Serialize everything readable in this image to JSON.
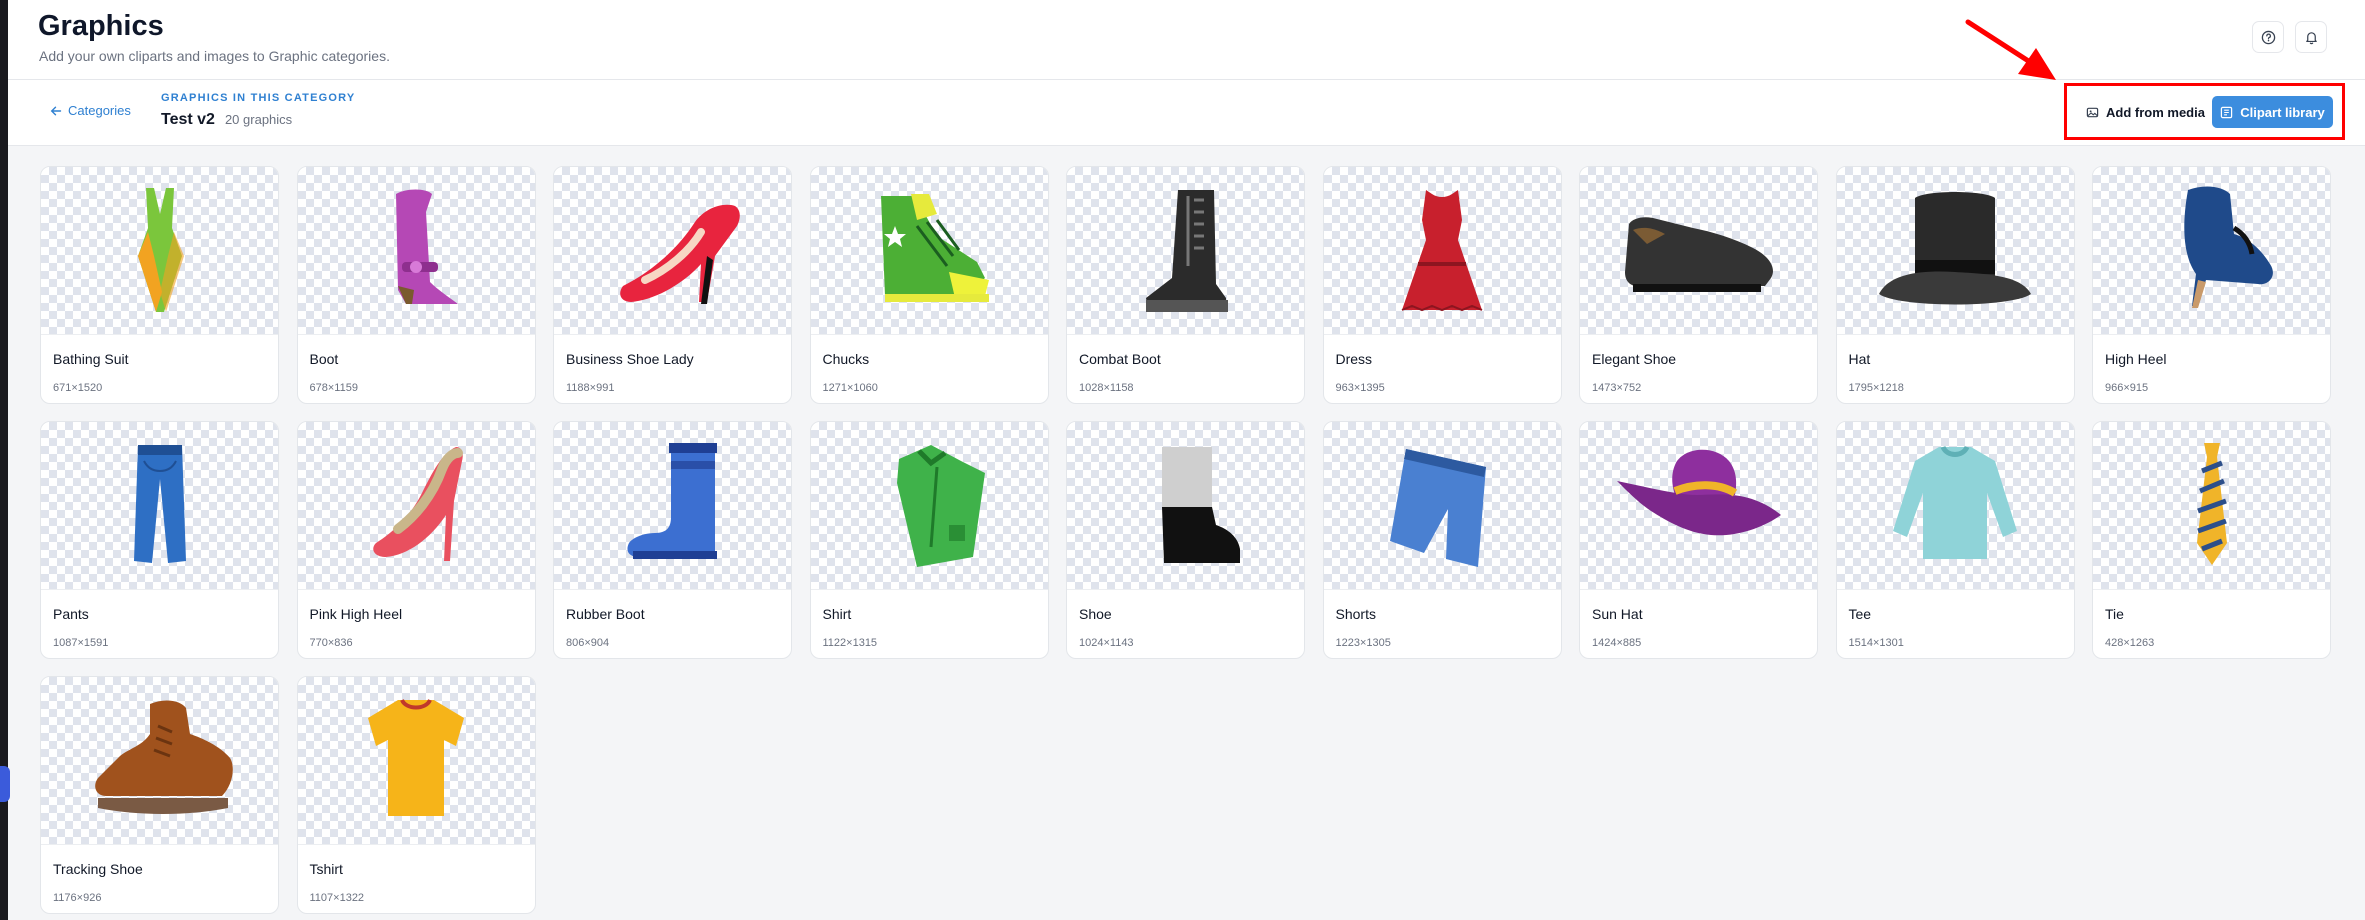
{
  "header": {
    "title": "Graphics",
    "subtitle": "Add your own cliparts and images to Graphic categories.",
    "icons": [
      "help-icon",
      "bell-icon"
    ]
  },
  "subbar": {
    "back_label": "Categories",
    "overline": "GRAPHICS IN THIS CATEGORY",
    "category_name": "Test v2",
    "count_label": "20 graphics",
    "add_media_label": "Add from media",
    "clipart_label": "Clipart library"
  },
  "colors": {
    "accent": "#3c8dde",
    "link": "#2f80d1",
    "annotation": "#ff0000"
  },
  "graphics": [
    {
      "name": "Bathing Suit",
      "dims": "671×1520",
      "icon": "bathing-suit-icon"
    },
    {
      "name": "Boot",
      "dims": "678×1159",
      "icon": "boot-icon"
    },
    {
      "name": "Business Shoe Lady",
      "dims": "1188×991",
      "icon": "business-shoe-lady-icon"
    },
    {
      "name": "Chucks",
      "dims": "1271×1060",
      "icon": "chucks-icon"
    },
    {
      "name": "Combat Boot",
      "dims": "1028×1158",
      "icon": "combat-boot-icon"
    },
    {
      "name": "Dress",
      "dims": "963×1395",
      "icon": "dress-icon"
    },
    {
      "name": "Elegant Shoe",
      "dims": "1473×752",
      "icon": "elegant-shoe-icon"
    },
    {
      "name": "Hat",
      "dims": "1795×1218",
      "icon": "hat-icon"
    },
    {
      "name": "High Heel",
      "dims": "966×915",
      "icon": "high-heel-icon"
    },
    {
      "name": "Pants",
      "dims": "1087×1591",
      "icon": "pants-icon"
    },
    {
      "name": "Pink High Heel",
      "dims": "770×836",
      "icon": "pink-high-heel-icon"
    },
    {
      "name": "Rubber Boot",
      "dims": "806×904",
      "icon": "rubber-boot-icon"
    },
    {
      "name": "Shirt",
      "dims": "1122×1315",
      "icon": "shirt-icon"
    },
    {
      "name": "Shoe",
      "dims": "1024×1143",
      "icon": "shoe-icon"
    },
    {
      "name": "Shorts",
      "dims": "1223×1305",
      "icon": "shorts-icon"
    },
    {
      "name": "Sun Hat",
      "dims": "1424×885",
      "icon": "sun-hat-icon"
    },
    {
      "name": "Tee",
      "dims": "1514×1301",
      "icon": "tee-icon"
    },
    {
      "name": "Tie",
      "dims": "428×1263",
      "icon": "tie-icon"
    },
    {
      "name": "Tracking Shoe",
      "dims": "1176×926",
      "icon": "tracking-shoe-icon"
    },
    {
      "name": "Tshirt",
      "dims": "1107×1322",
      "icon": "tshirt-icon"
    }
  ]
}
